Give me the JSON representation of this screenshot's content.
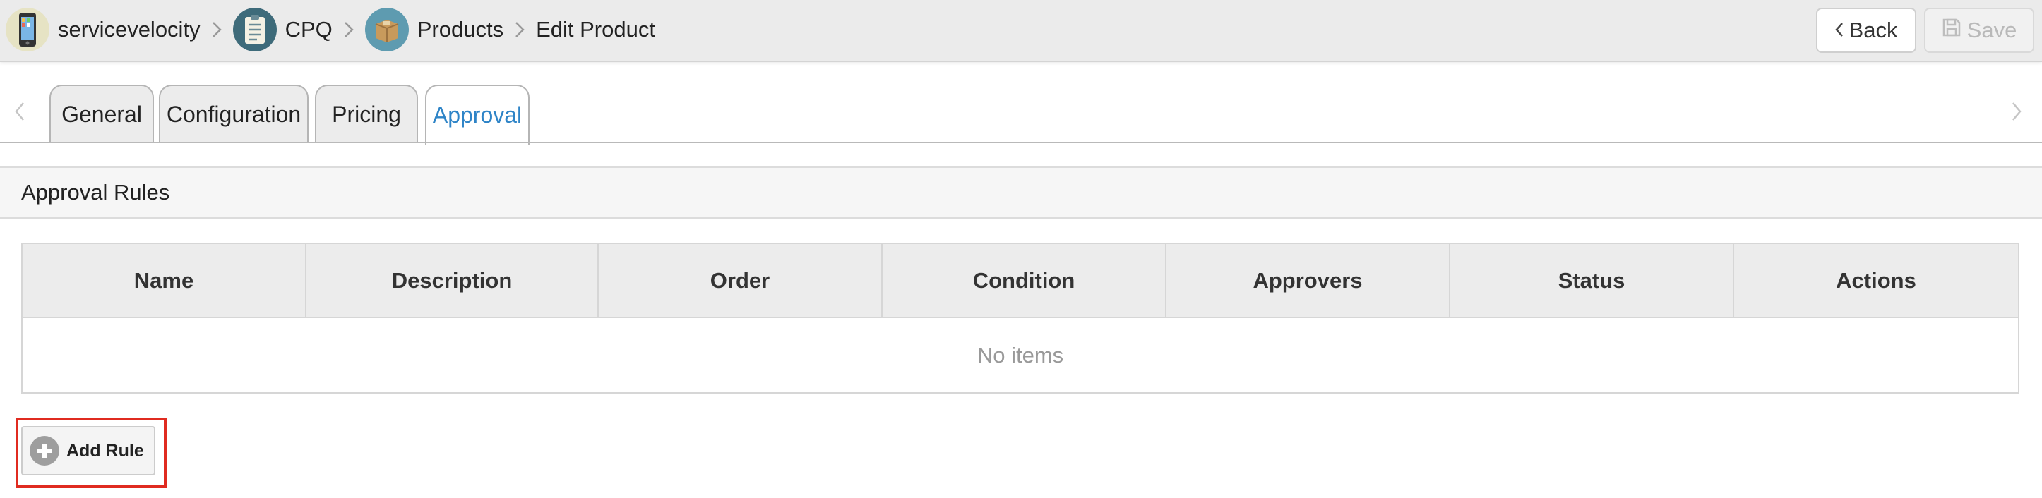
{
  "breadcrumb": {
    "items": [
      {
        "label": "servicevelocity",
        "icon": "phone-app-icon"
      },
      {
        "label": "CPQ",
        "icon": "clipboard-icon"
      },
      {
        "label": "Products",
        "icon": "box-icon"
      },
      {
        "label": "Edit Product"
      }
    ]
  },
  "toolbar": {
    "back_label": "Back",
    "save_label": "Save"
  },
  "tabs": [
    {
      "label": "General",
      "active": false
    },
    {
      "label": "Configuration",
      "active": false
    },
    {
      "label": "Pricing",
      "active": false
    },
    {
      "label": "Approval",
      "active": true
    }
  ],
  "section": {
    "title": "Approval Rules"
  },
  "table": {
    "columns": [
      "Name",
      "Description",
      "Order",
      "Condition",
      "Approvers",
      "Status",
      "Actions"
    ],
    "empty_text": "No items"
  },
  "actions": {
    "add_rule_label": "Add Rule"
  },
  "colors": {
    "active_tab": "#2e84c7",
    "highlight": "#e02b20"
  }
}
